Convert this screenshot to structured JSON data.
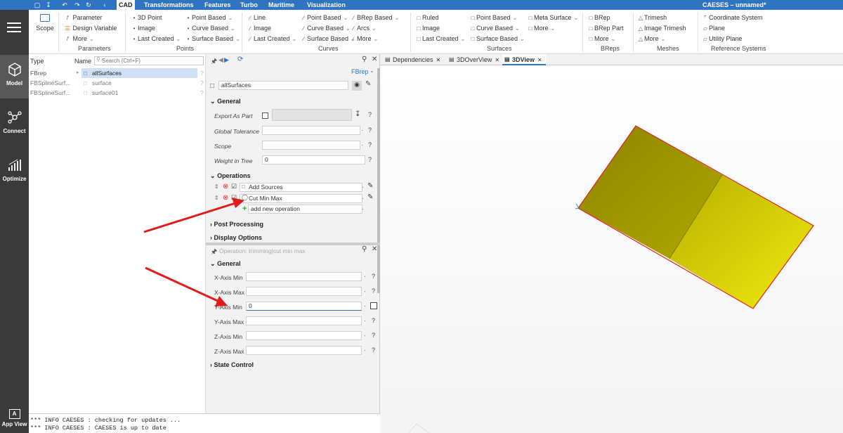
{
  "app_title": "CAESES  –  unnamed*",
  "menu_tabs": [
    "CAD",
    "Transformations",
    "Features",
    "Turbo",
    "Maritime",
    "Visualization"
  ],
  "ribbon": {
    "scope_label": "Scope",
    "parameters": {
      "items": [
        "Parameter",
        "Design Variable",
        "More"
      ],
      "group": "Parameters"
    },
    "points": {
      "col1": [
        "3D Point",
        "Image",
        "Last Created"
      ],
      "col2": [
        "Point Based",
        "Curve Based",
        "Surface Based"
      ],
      "group": "Points"
    },
    "curves": {
      "col1": [
        "Line",
        "Image",
        "Last Created"
      ],
      "col2": [
        "Point Based",
        "Curve Based",
        "Surface Based"
      ],
      "col3": [
        "BRep Based",
        "Arcs",
        "More"
      ],
      "group": "Curves"
    },
    "surfaces": {
      "col1": [
        "Ruled",
        "Image",
        "Last Created"
      ],
      "col2": [
        "Point Based",
        "Curve Based",
        "Surface Based"
      ],
      "col3": [
        "Meta Surface",
        "More"
      ],
      "group": "Surfaces"
    },
    "breps": {
      "items": [
        "BRep",
        "BRep Part",
        "More"
      ],
      "group": "BReps"
    },
    "meshes": {
      "items": [
        "Trimesh",
        "Image Trimesh",
        "More"
      ],
      "group": "Meshes"
    },
    "refsys": {
      "items": [
        "Coordinate System",
        "Plane",
        "Utility Plane"
      ],
      "group": "Reference Systems"
    }
  },
  "nav": [
    {
      "label": "Model",
      "icon": "cube-icon"
    },
    {
      "label": "Connect",
      "icon": "connect-icon"
    },
    {
      "label": "Optimize",
      "icon": "optimize-icon"
    },
    {
      "label": "App View",
      "icon": "app-view-icon"
    }
  ],
  "tree": {
    "col_type": "Type",
    "col_name": "Name",
    "search_placeholder": "Search (Ctrl+F)",
    "rows": [
      {
        "type": "FBrep",
        "name": "allSurfaces",
        "q": "?"
      },
      {
        "type": "FBSplineSurf...",
        "name": "surface",
        "q": "?"
      },
      {
        "type": "FBSplineSurf...",
        "name": "surface01",
        "q": "?"
      }
    ]
  },
  "props": {
    "type_label": "FBrep",
    "object_name": "allSurfaces",
    "general": "General",
    "export_as_part": "Export As Part",
    "global_tolerance": "Global Tolerance",
    "scope": "Scope",
    "weight_in_tree": "Weight in Tree",
    "weight_value": "0",
    "operations": "Operations",
    "op1": "Add Sources",
    "op2": "Cut Min Max",
    "add_op": "add new operation",
    "post_processing": "Post Processing",
    "display_options": "Display Options",
    "operation_title": "Operation: trimming|cut min max",
    "general2": "General",
    "axes": [
      {
        "label": "X-Axis Min",
        "value": ""
      },
      {
        "label": "X-Axis Max",
        "value": ""
      },
      {
        "label": "Y-Axis Min",
        "value": "0"
      },
      {
        "label": "Y-Axis Max",
        "value": ""
      },
      {
        "label": "Z-Axis Min",
        "value": ""
      },
      {
        "label": "Z-Axis Max",
        "value": ""
      }
    ],
    "state_control": "State Control",
    "q": "?"
  },
  "console": [
    "*** INFO CAESES : checking for updates ...",
    "*** INFO CAESES : CAESES is up to date"
  ],
  "view_tabs": [
    "Dependencies",
    "3DOverView",
    "3DView"
  ],
  "colors": {
    "accent": "#2f74c0",
    "nav_bg": "#3a3a3a",
    "surface_yellow": "#c8c000",
    "arrow_red": "#e21b1b"
  }
}
